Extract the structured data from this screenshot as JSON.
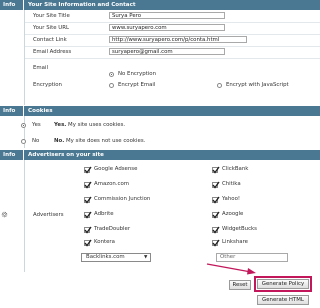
{
  "info_section": {
    "header_left": "Info",
    "header_title": "Your Site Information and Contact",
    "site_title_label": "Your Site Title",
    "site_title_value": "Surya Pero",
    "site_url_label": "Your Site URL",
    "site_url_value": "www.suryapero.com",
    "contact_link_label": "Contact Link",
    "contact_link_value": "http://www.suryapero.com/p/conta.html",
    "email_label": "Email Address",
    "email_value": "suryapero@gmail.com",
    "email_encryption_label_1": "Email",
    "email_encryption_label_2": "Encryption",
    "no_encryption_label": "No Encryption",
    "encrypt_email_label": "Encrypt Email",
    "encrypt_js_label": "Encrypt with JavaScript"
  },
  "cookies_section": {
    "header_left": "Info",
    "header_title": "Cookies",
    "yes_label": "Yes",
    "yes_desc_bold": "Yes.",
    "yes_desc": " My site uses cookies.",
    "no_label": "No",
    "no_desc_bold": "No.",
    "no_desc": " My site does not use cookies."
  },
  "ads_section": {
    "header_left": "Info",
    "header_title": "Advertisers on your site",
    "advertisers_label": "Advertisers",
    "left_items": [
      {
        "label": "Google Adsense",
        "checked": true
      },
      {
        "label": "Amazon.com",
        "checked": true
      },
      {
        "label": "Commission Junction",
        "checked": true
      },
      {
        "label": "Adbrite",
        "checked": true
      },
      {
        "label": "TradeDoubler",
        "checked": true
      },
      {
        "label": "Kontera",
        "checked": true
      }
    ],
    "right_items": [
      {
        "label": "ClickBank",
        "checked": true
      },
      {
        "label": "Chitika",
        "checked": true
      },
      {
        "label": "Yahoo!",
        "checked": true
      },
      {
        "label": "Azoogle",
        "checked": true
      },
      {
        "label": "WidgetBucks",
        "checked": true
      },
      {
        "label": "Linkshare",
        "checked": true
      }
    ],
    "select_value": "Backlinks.com",
    "other_placeholder": "Other"
  },
  "actions": {
    "reset_label": "Reset",
    "generate_policy_label": "Generate Policy",
    "generate_html_label": "Generate HTML"
  },
  "colors": {
    "header_bg": "#4a7892",
    "highlight": "#c2185b"
  }
}
